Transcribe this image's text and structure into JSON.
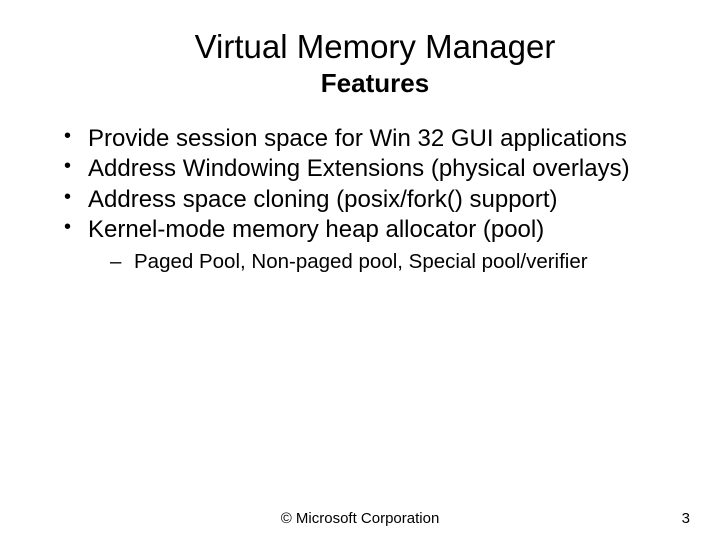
{
  "title": "Virtual Memory Manager",
  "subtitle": "Features",
  "bullets": {
    "b0": "Provide session space for Win 32 GUI applications",
    "b1": "Address Windowing Extensions (physical overlays)",
    "b2": "Address space cloning (posix/fork() support)",
    "b3": "Kernel-mode memory heap allocator (pool)",
    "b3_sub0": "Paged Pool, Non-paged pool, Special pool/verifier"
  },
  "footer": {
    "copyright": "© Microsoft Corporation",
    "page": "3"
  }
}
